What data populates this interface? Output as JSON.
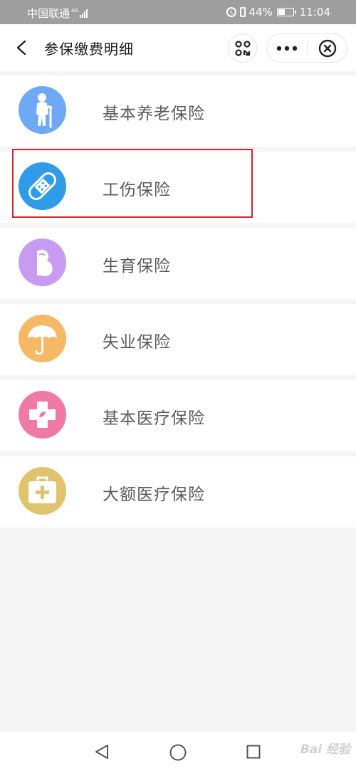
{
  "status_bar": {
    "carrier": "中国联通",
    "network_tag": "4G",
    "battery": "44%",
    "time": "11:04",
    "icons": [
      "signal-icon",
      "alarm-icon",
      "vibrate-icon",
      "battery-icon"
    ]
  },
  "nav": {
    "title": "参保缴费明细",
    "back_icon": "chevron-left-icon",
    "scan_icon": "scan-icon",
    "more_icon": "more-dots-icon",
    "close_icon": "close-circle-icon"
  },
  "items": [
    {
      "label": "基本养老保险",
      "icon": "elderly-person-icon",
      "color": "#6ea8f7"
    },
    {
      "label": "工伤保险",
      "icon": "bandage-icon",
      "color": "#2f9be9"
    },
    {
      "label": "生育保险",
      "icon": "pregnancy-icon",
      "color": "#c79bf2"
    },
    {
      "label": "失业保险",
      "icon": "umbrella-icon",
      "color": "#f5b865"
    },
    {
      "label": "基本医疗保险",
      "icon": "medical-cross-icon",
      "color": "#ef7aa4"
    },
    {
      "label": "大额医疗保险",
      "icon": "first-aid-kit-icon",
      "color": "#e0c46d"
    }
  ],
  "highlight_color": "#d6232c",
  "system_nav": {
    "icons": [
      "triangle-back-icon",
      "circle-home-icon",
      "square-recent-icon"
    ]
  },
  "watermark": "Bai 经验"
}
